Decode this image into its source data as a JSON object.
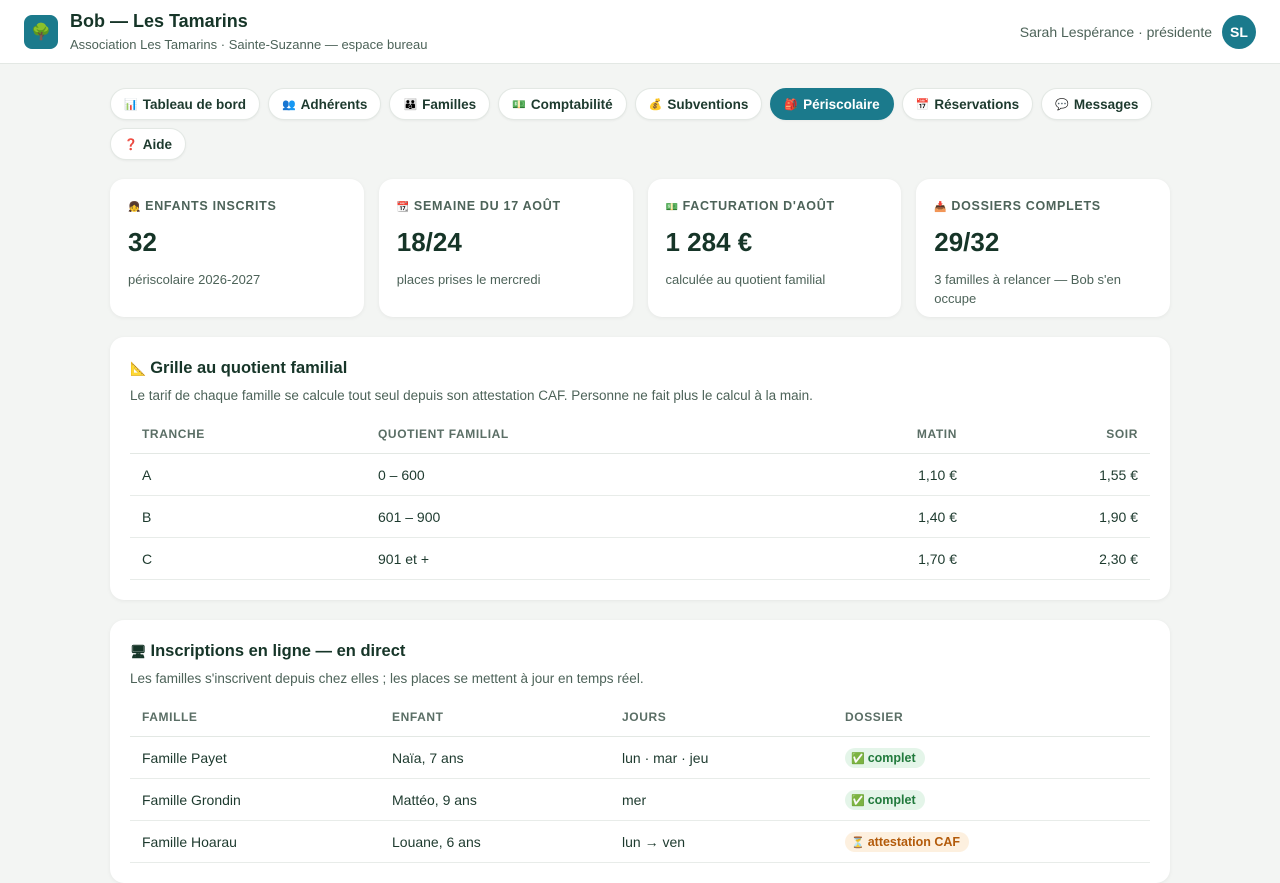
{
  "header": {
    "logo_icon": "🌳",
    "title": "Bob — Les Tamarins",
    "subtitle": "Association Les Tamarins · Sainte-Suzanne — espace bureau",
    "user_name": "Sarah Lespérance · présidente",
    "avatar_initials": "SL"
  },
  "tabs": [
    {
      "icon": "📊",
      "label": "Tableau de bord"
    },
    {
      "icon": "👥",
      "label": "Adhérents"
    },
    {
      "icon": "👪",
      "label": "Familles"
    },
    {
      "icon": "💵",
      "label": "Comptabilité"
    },
    {
      "icon": "💰",
      "label": "Subventions"
    },
    {
      "icon": "🎒",
      "label": "Périscolaire",
      "active": true
    },
    {
      "icon": "📅",
      "label": "Réservations"
    },
    {
      "icon": "💬",
      "label": "Messages"
    },
    {
      "icon": "❓",
      "label": "Aide"
    }
  ],
  "stats": [
    {
      "icon": "👧",
      "label": "Enfants inscrits",
      "value": "32",
      "sub": "périscolaire 2026-2027"
    },
    {
      "icon": "📆",
      "label": "Semaine du 17 août",
      "value": "18/24",
      "sub": "places prises le mercredi"
    },
    {
      "icon": "💵",
      "label": "Facturation d'août",
      "value": "1 284 €",
      "sub": "calculée au quotient familial"
    },
    {
      "icon": "📥",
      "label": "Dossiers complets",
      "value": "29/32",
      "sub": "3 familles à relancer — Bob s'en occupe"
    }
  ],
  "grid": {
    "icon": "📐",
    "title": "Grille au quotient familial",
    "desc": "Le tarif de chaque famille se calcule tout seul depuis son attestation CAF. Personne ne fait plus le calcul à la main.",
    "headers": [
      "Tranche",
      "Quotient familial",
      "Matin",
      "Soir"
    ],
    "rows": [
      [
        "A",
        "0 – 600",
        "1,10 €",
        "1,55 €"
      ],
      [
        "B",
        "601 – 900",
        "1,40 €",
        "1,90 €"
      ],
      [
        "C",
        "901 et +",
        "1,70 €",
        "2,30 €"
      ]
    ]
  },
  "signups": {
    "icon": "🖥",
    "title": "Inscriptions en ligne — en direct",
    "desc": "Les familles s'inscrivent depuis chez elles ; les places se mettent à jour en temps réel.",
    "headers": [
      "Famille",
      "Enfant",
      "Jours",
      "Dossier"
    ],
    "rows": [
      {
        "famille": "Famille Payet",
        "enfant": "Naïa, 7 ans",
        "jours": "lun · mar · jeu",
        "status_icon": "✅",
        "status": "complet",
        "tone": "ok"
      },
      {
        "famille": "Famille Grondin",
        "enfant": "Mattéo, 9 ans",
        "jours": "mer",
        "status_icon": "✅",
        "status": "complet",
        "tone": "ok"
      },
      {
        "famille": "Famille Hoarau",
        "enfant": "Louane, 6 ans",
        "jours": "lun → ven",
        "status_icon": "⏳",
        "status": "attestation CAF",
        "tone": "warn"
      }
    ]
  },
  "colors": {
    "accent": "#1b7a8c",
    "background": "#f3f5f3",
    "ok": "#217a3c",
    "warn": "#b35b0b"
  }
}
